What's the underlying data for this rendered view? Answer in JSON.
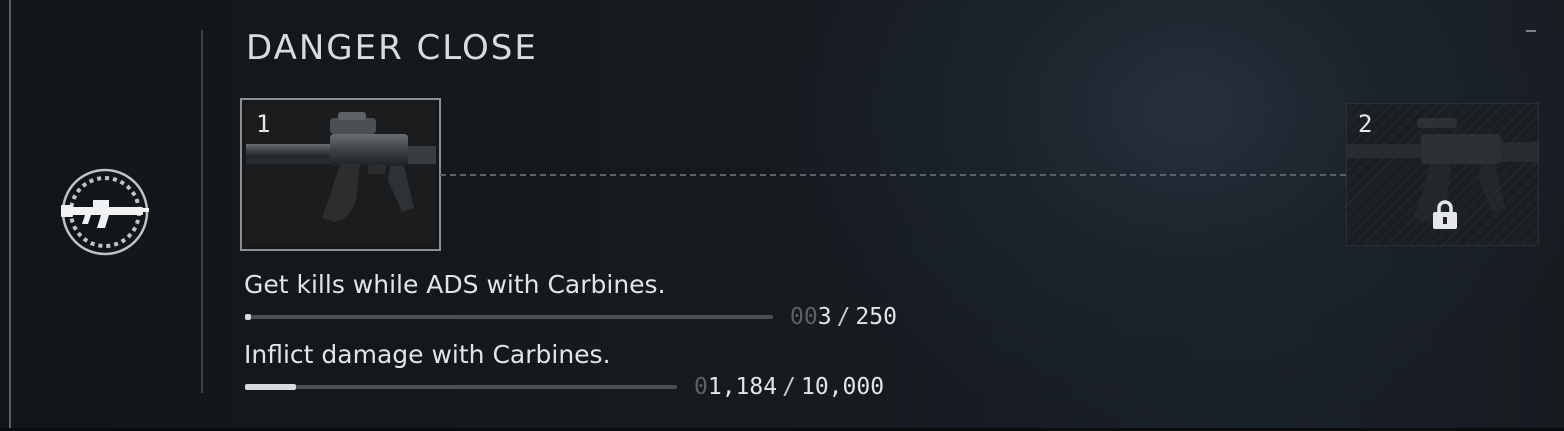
{
  "challenge": {
    "title": "DANGER CLOSE",
    "badge_icon": "carbine-badge-icon",
    "tiers": [
      {
        "number": "1",
        "state": "unlocked",
        "icon": "carbine-rifle-image"
      },
      {
        "number": "2",
        "state": "locked",
        "icon": "lock-icon"
      }
    ],
    "objectives": [
      {
        "text": "Get kills while ADS with Carbines.",
        "progress_dim": "00",
        "progress_lit": "3",
        "separator": "/",
        "goal": "250",
        "progress_fraction": 0.012
      },
      {
        "text": "Inflict damage with Carbines.",
        "progress_dim": "0",
        "progress_lit": "1,184",
        "separator": "/",
        "goal": "10,000",
        "progress_fraction": 0.1184
      }
    ]
  },
  "colors": {
    "background": "#161b20",
    "text": "#e2e5e7",
    "dim_digits": "#5c6166",
    "track": "#4b5054",
    "fill": "#d8dadc"
  }
}
